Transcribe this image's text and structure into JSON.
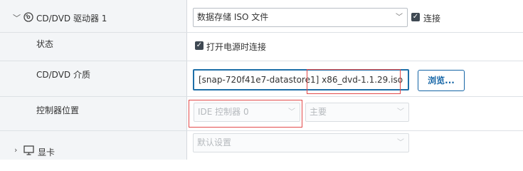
{
  "cd_dvd": {
    "title": "CD/DVD 驱动器 1",
    "type_select": "数据存储 ISO 文件",
    "connect_label": "连接",
    "status_label": "状态",
    "power_on_connect_label": "打开电源时连接",
    "media_label": "CD/DVD 介质",
    "media_path": "[snap-720f41e7-datastore1] x86_dvd-1.1.29.iso",
    "browse_button": "浏览...",
    "controller_label": "控制器位置",
    "controller_select": "IDE 控制器 0",
    "controller_slot_select": "主要"
  },
  "display_card": {
    "title": "显卡",
    "setting_select": "默认设置"
  },
  "icons": {
    "chevron": "chevron-icon",
    "disc": "disc-icon",
    "monitor": "monitor-icon",
    "caret": "caret-down-icon",
    "check": "check-icon"
  },
  "colors": {
    "accent": "#1565a6",
    "highlight": "#e24a4a",
    "checkbox": "#3f4953"
  }
}
